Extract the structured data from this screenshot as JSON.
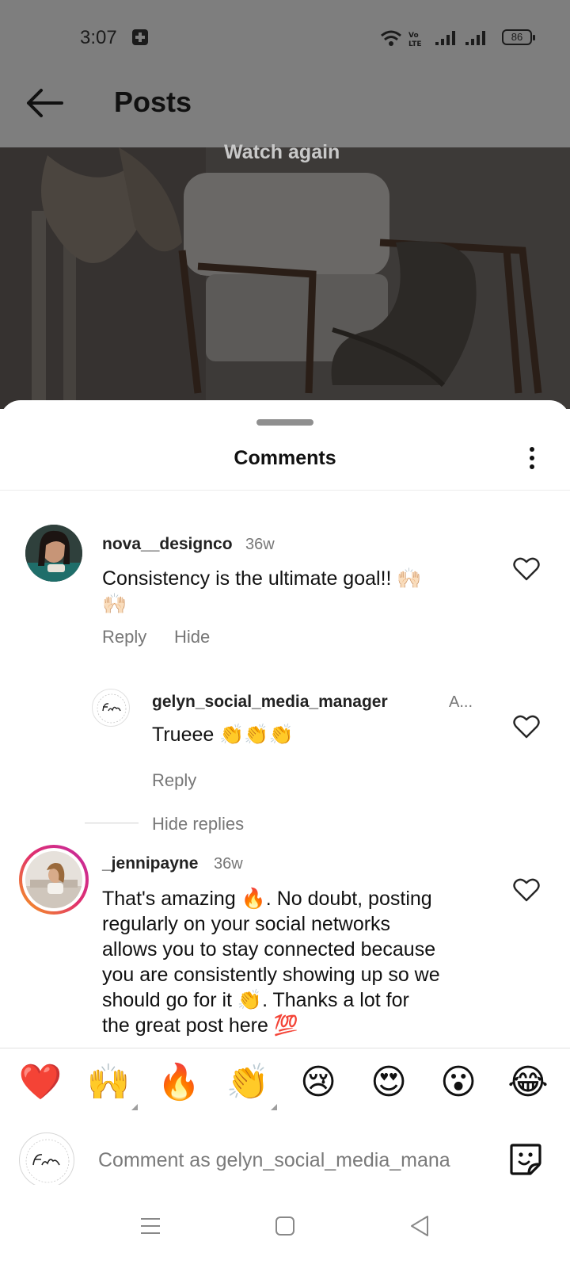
{
  "status_bar": {
    "time": "3:07",
    "battery": "86"
  },
  "app_bar": {
    "title": "Posts"
  },
  "post": {
    "overlay_text": "Watch again"
  },
  "comments_sheet": {
    "title": "Comments",
    "comments": [
      {
        "username": "nova__designco",
        "time": "36w",
        "text_line1": "Consistency is the ultimate goal!! 🙌🏻",
        "text_line2": "🙌🏻",
        "reply_label": "Reply",
        "hide_label": "Hide"
      },
      {
        "username": "gelyn_social_media_manager",
        "time": "A...",
        "text": "Trueee 👏👏👏",
        "reply_label": "Reply"
      },
      {
        "username": "_jennipayne",
        "time": "36w",
        "text_lines": [
          "That's amazing 🔥. No doubt, posting",
          "regularly on your social networks",
          "allows you to stay connected because",
          "you are consistently showing up so we",
          "should go for it 👏. Thanks a lot for",
          "the great post here 💯"
        ]
      }
    ],
    "hide_replies_label": "Hide replies"
  },
  "quick_reactions": [
    "❤️",
    "🙌",
    "🔥",
    "👏",
    "😢",
    "😍",
    "😮",
    "😂"
  ],
  "compose": {
    "placeholder": "Comment as gelyn_social_media_mana"
  },
  "colors": {
    "heart_red": "#e8202f",
    "muted_text": "#777777",
    "story_ring_start": "#c32aa3",
    "story_ring_end": "#f7a21b"
  }
}
